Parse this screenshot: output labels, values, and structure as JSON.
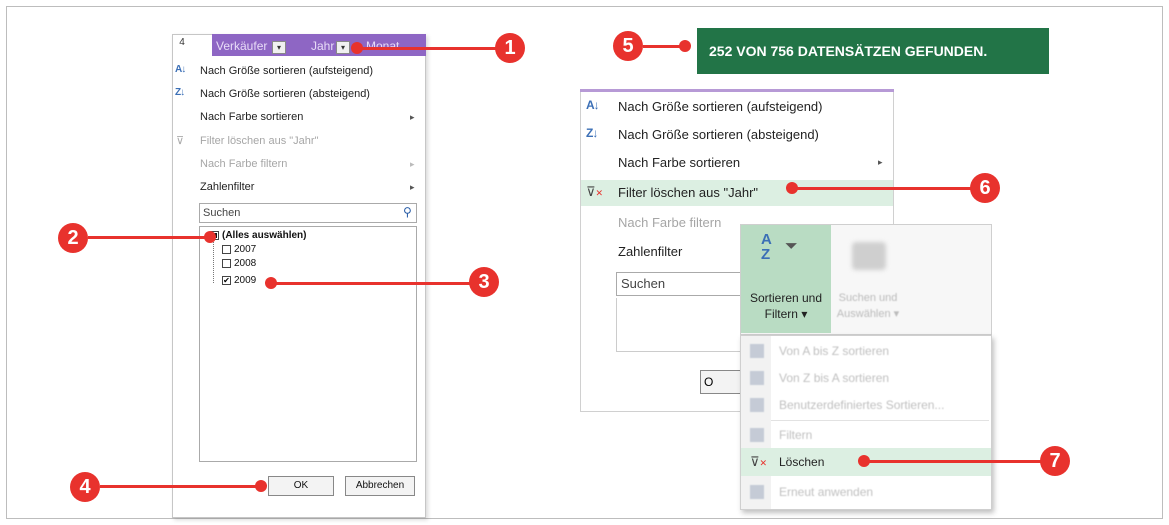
{
  "left": {
    "row_number": "4",
    "header": {
      "col1": "Verkäufer",
      "col2": "Jahr",
      "col3_partial": "Monat"
    },
    "menu": [
      {
        "icon": "A↓Z",
        "label": "Nach Größe sortieren (aufsteigend)",
        "enabled": true
      },
      {
        "icon": "Z↓A",
        "label": "Nach Größe sortieren (absteigend)",
        "enabled": true
      },
      {
        "icon": "",
        "label": "Nach Farbe sortieren",
        "enabled": true,
        "submenu": true
      },
      {
        "icon": "filter-clear",
        "label": "Filter löschen aus \"Jahr\"",
        "enabled": false
      },
      {
        "icon": "",
        "label": "Nach Farbe filtern",
        "enabled": false,
        "submenu": true
      },
      {
        "icon": "",
        "label": "Zahlenfilter",
        "enabled": true,
        "submenu": true
      }
    ],
    "search_placeholder": "Suchen",
    "list": [
      {
        "label": "(Alles auswählen)",
        "state": "partial"
      },
      {
        "label": "2007",
        "state": "unchecked"
      },
      {
        "label": "2008",
        "state": "unchecked"
      },
      {
        "label": "2009",
        "state": "checked"
      }
    ],
    "ok_label": "OK",
    "cancel_label": "Abbrechen"
  },
  "right": {
    "status": "252 VON 756 DATENSÄTZEN GEFUNDEN.",
    "menu": [
      {
        "label": "Nach Größe sortieren (aufsteigend)",
        "enabled": true
      },
      {
        "label": "Nach Größe sortieren (absteigend)",
        "enabled": true
      },
      {
        "label": "Nach Farbe sortieren",
        "enabled": true
      },
      {
        "label": "Filter löschen aus \"Jahr\"",
        "enabled": true
      },
      {
        "label": "Nach Farbe filtern",
        "enabled": false
      },
      {
        "label": "Zahlenfilter",
        "enabled": true
      }
    ],
    "search_placeholder": "Suchen",
    "button_partial": "O",
    "ribbon": {
      "sort_filter_line1": "Sortieren und",
      "sort_filter_line2": "Filtern ▾",
      "find_select_line1": "Suchen und",
      "find_select_line2": "Auswählen ▾"
    },
    "dropdown": [
      {
        "label": "Von A bis Z sortieren",
        "enabled": false
      },
      {
        "label": "Von Z bis A sortieren",
        "enabled": false
      },
      {
        "label": "Benutzerdefiniertes Sortieren...",
        "enabled": false
      },
      {
        "label": "Filtern",
        "enabled": false
      },
      {
        "label": "Löschen",
        "enabled": true
      },
      {
        "label": "Erneut anwenden",
        "enabled": false
      }
    ]
  },
  "callouts": [
    "1",
    "2",
    "3",
    "4",
    "5",
    "6",
    "7"
  ],
  "colors": {
    "callout": "#e8322d",
    "header_purple": "#8e66c4",
    "status_green": "#227447",
    "highlight_green": "#dcefe2",
    "ribbon_active": "#b9dcc3"
  }
}
